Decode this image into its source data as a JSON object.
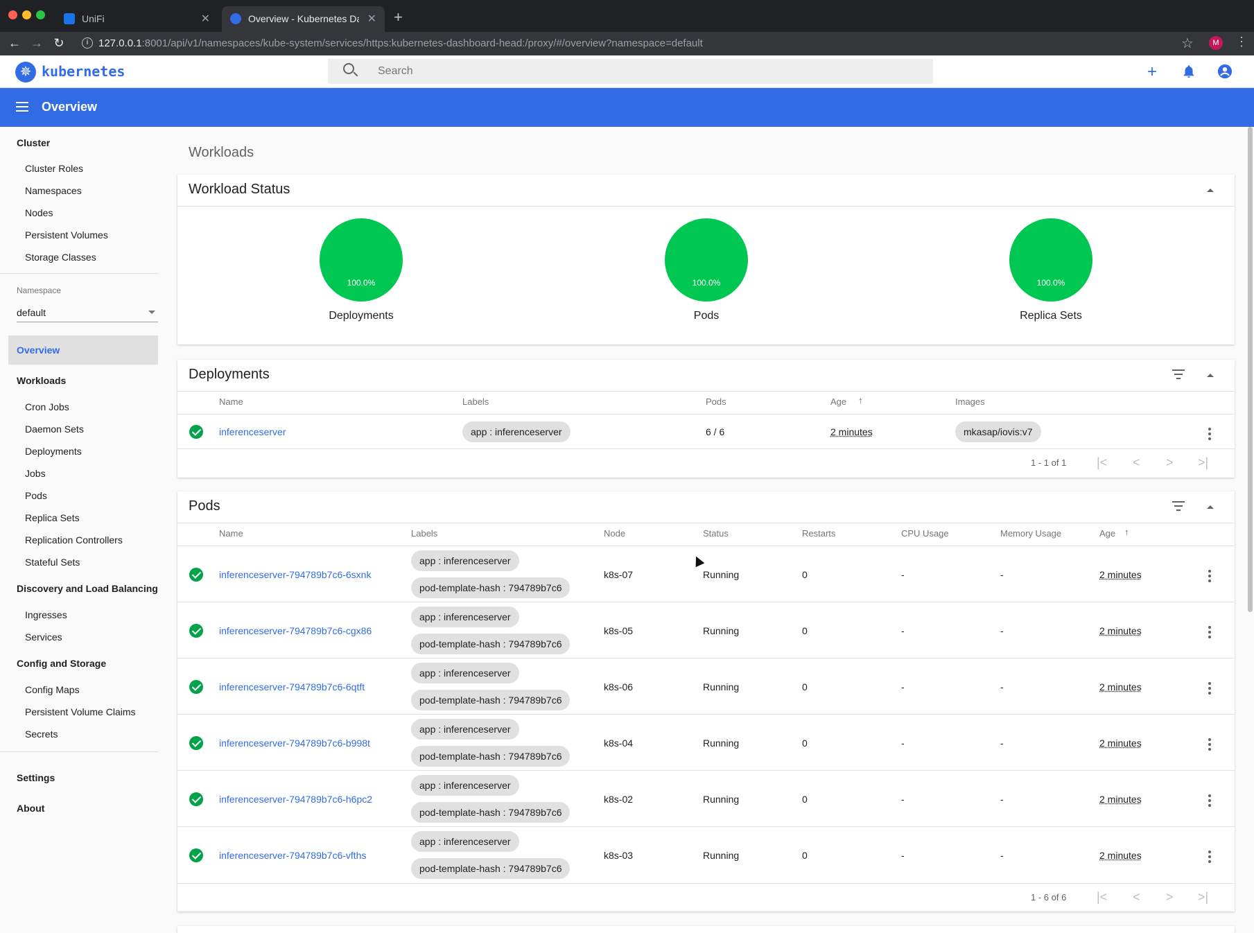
{
  "browser": {
    "tabs": [
      {
        "title": "UniFi"
      },
      {
        "title": "Overview - Kubernetes Dashbo"
      }
    ],
    "url_host": "127.0.0.1",
    "url_rest": ":8001/api/v1/namespaces/kube-system/services/https:kubernetes-dashboard-head:/proxy/#/overview?namespace=default",
    "profile_initial": "M"
  },
  "header": {
    "brand": "kubernetes",
    "search_placeholder": "Search"
  },
  "toolbar": {
    "title": "Overview"
  },
  "sidebar": {
    "cluster_heading": "Cluster",
    "cluster_items": [
      "Cluster Roles",
      "Namespaces",
      "Nodes",
      "Persistent Volumes",
      "Storage Classes"
    ],
    "namespace_label": "Namespace",
    "namespace_value": "default",
    "overview": "Overview",
    "workloads_heading": "Workloads",
    "workload_items": [
      "Cron Jobs",
      "Daemon Sets",
      "Deployments",
      "Jobs",
      "Pods",
      "Replica Sets",
      "Replication Controllers",
      "Stateful Sets"
    ],
    "discovery_heading": "Discovery and Load Balancing",
    "discovery_items": [
      "Ingresses",
      "Services"
    ],
    "config_heading": "Config and Storage",
    "config_items": [
      "Config Maps",
      "Persistent Volume Claims",
      "Secrets"
    ],
    "settings": "Settings",
    "about": "About"
  },
  "main": {
    "section_title": "Workloads",
    "workload_status": {
      "title": "Workload Status",
      "charts": [
        {
          "label": "Deployments",
          "percent": "100.0%"
        },
        {
          "label": "Pods",
          "percent": "100.0%"
        },
        {
          "label": "Replica Sets",
          "percent": "100.0%"
        }
      ]
    },
    "deployments": {
      "title": "Deployments",
      "columns": [
        "Name",
        "Labels",
        "Pods",
        "Age",
        "Images"
      ],
      "rows": [
        {
          "name": "inferenceserver",
          "label": "app : inferenceserver",
          "pods": "6 / 6",
          "age": "2 minutes",
          "image": "mkasap/iovis:v7"
        }
      ],
      "pagination": "1 - 1 of 1"
    },
    "pods": {
      "title": "Pods",
      "columns": [
        "Name",
        "Labels",
        "Node",
        "Status",
        "Restarts",
        "CPU Usage",
        "Memory Usage",
        "Age"
      ],
      "rows": [
        {
          "name": "inferenceserver-794789b7c6-6sxnk",
          "label1": "app : inferenceserver",
          "label2": "pod-template-hash : 794789b7c6",
          "node": "k8s-07",
          "status": "Running",
          "restarts": "0",
          "cpu": "-",
          "mem": "-",
          "age": "2 minutes"
        },
        {
          "name": "inferenceserver-794789b7c6-cgx86",
          "label1": "app : inferenceserver",
          "label2": "pod-template-hash : 794789b7c6",
          "node": "k8s-05",
          "status": "Running",
          "restarts": "0",
          "cpu": "-",
          "mem": "-",
          "age": "2 minutes"
        },
        {
          "name": "inferenceserver-794789b7c6-6qtft",
          "label1": "app : inferenceserver",
          "label2": "pod-template-hash : 794789b7c6",
          "node": "k8s-06",
          "status": "Running",
          "restarts": "0",
          "cpu": "-",
          "mem": "-",
          "age": "2 minutes"
        },
        {
          "name": "inferenceserver-794789b7c6-b998t",
          "label1": "app : inferenceserver",
          "label2": "pod-template-hash : 794789b7c6",
          "node": "k8s-04",
          "status": "Running",
          "restarts": "0",
          "cpu": "-",
          "mem": "-",
          "age": "2 minutes"
        },
        {
          "name": "inferenceserver-794789b7c6-h6pc2",
          "label1": "app : inferenceserver",
          "label2": "pod-template-hash : 794789b7c6",
          "node": "k8s-02",
          "status": "Running",
          "restarts": "0",
          "cpu": "-",
          "mem": "-",
          "age": "2 minutes"
        },
        {
          "name": "inferenceserver-794789b7c6-vfths",
          "label1": "app : inferenceserver",
          "label2": "pod-template-hash : 794789b7c6",
          "node": "k8s-03",
          "status": "Running",
          "restarts": "0",
          "cpu": "-",
          "mem": "-",
          "age": "2 minutes"
        }
      ],
      "pagination": "1 - 6 of 6"
    }
  },
  "colors": {
    "accent": "#326ce5",
    "success": "#00c752",
    "browser_dark": "#202124"
  }
}
